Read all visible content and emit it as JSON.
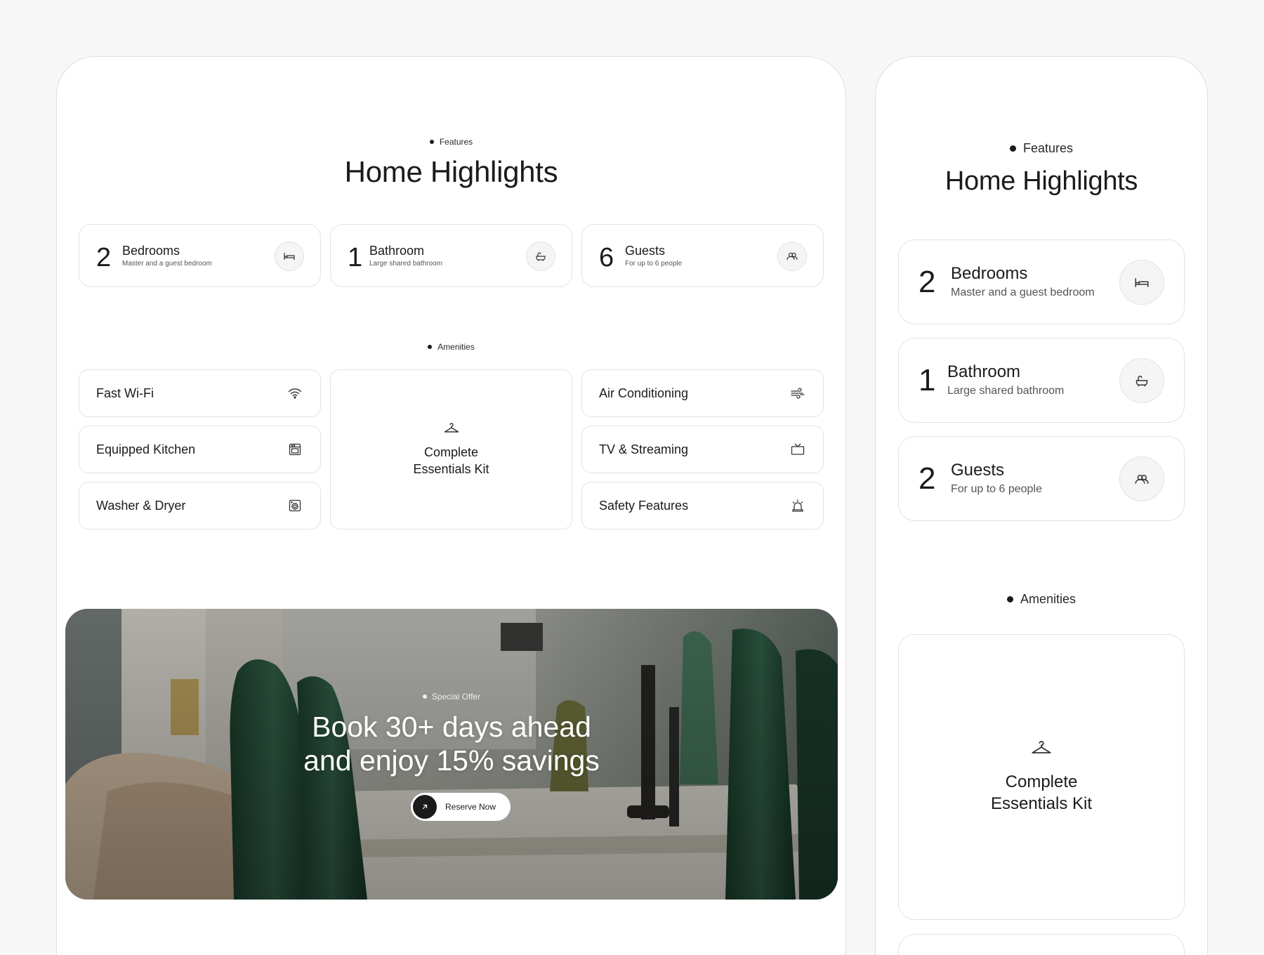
{
  "desktop": {
    "features_eyebrow": "Features",
    "title": "Home Highlights",
    "highlights": [
      {
        "num": "2",
        "label": "Bedrooms",
        "sub": "Master and a guest bedroom",
        "icon": "bed-icon"
      },
      {
        "num": "1",
        "label": "Bathroom",
        "sub": "Large shared bathroom",
        "icon": "bathtub-icon"
      },
      {
        "num": "6",
        "label": "Guests",
        "sub": "For up to 6 people",
        "icon": "guests-icon"
      }
    ],
    "amenities_eyebrow": "Amenities",
    "amenities_left": [
      {
        "label": "Fast Wi-Fi",
        "icon": "wifi-icon"
      },
      {
        "label": "Equipped Kitchen",
        "icon": "oven-icon"
      },
      {
        "label": "Washer & Dryer",
        "icon": "washer-icon"
      }
    ],
    "kit_label": "Complete Essentials Kit",
    "amenities_right": [
      {
        "label": "Air Conditioning",
        "icon": "air-icon"
      },
      {
        "label": "TV & Streaming",
        "icon": "tv-icon"
      },
      {
        "label": "Safety Features",
        "icon": "alarm-icon"
      }
    ],
    "promo": {
      "eyebrow": "Special Offer",
      "title_line1": "Book 30+ days ahead",
      "title_line2": "and enjoy 15% savings",
      "button_label": "Reserve Now"
    }
  },
  "mobile": {
    "features_eyebrow": "Features",
    "title": "Home Highlights",
    "highlights": [
      {
        "num": "2",
        "label": "Bedrooms",
        "sub": "Master and a guest bedroom",
        "icon": "bed-icon"
      },
      {
        "num": "1",
        "label": "Bathroom",
        "sub": "Large shared bathroom",
        "icon": "bathtub-icon"
      },
      {
        "num": "2",
        "label": "Guests",
        "sub": "For up to 6 people",
        "icon": "guests-icon"
      }
    ],
    "amenities_eyebrow": "Amenities",
    "kit_label": "Complete Essentials Kit"
  }
}
